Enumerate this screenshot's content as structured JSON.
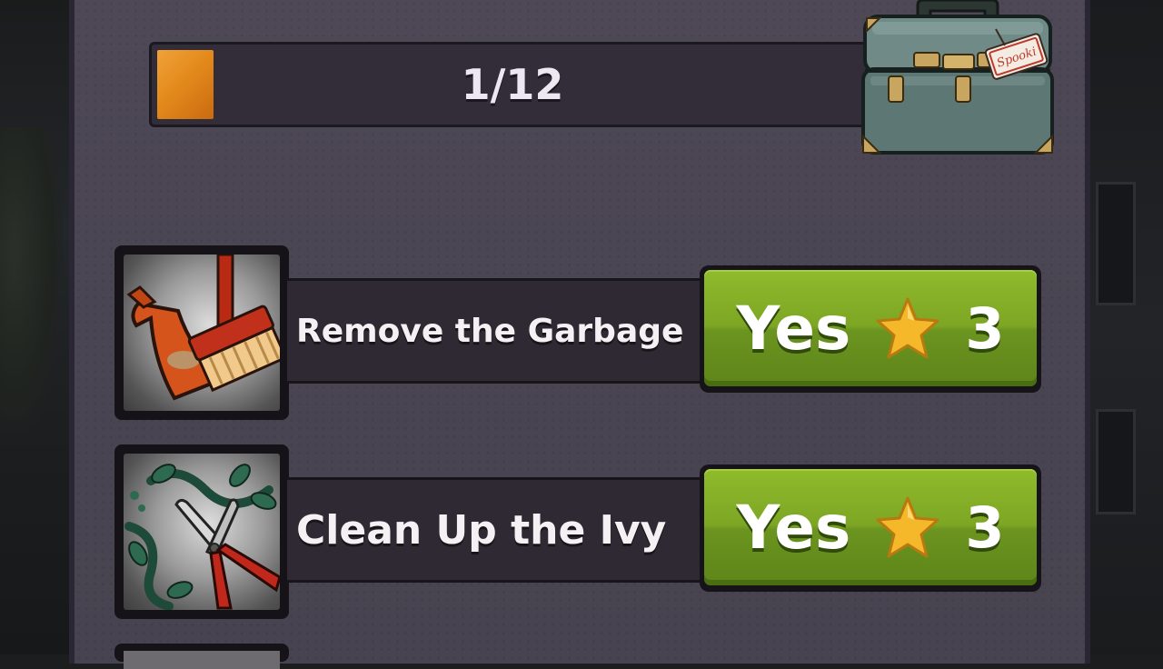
{
  "progress": {
    "text": "1/12",
    "current": 1,
    "total": 12,
    "fill_color": "#e48a1c"
  },
  "reward_box": {
    "icon": "toolbox-icon",
    "tag_text": "Spooki"
  },
  "tasks": [
    {
      "label": "Remove the Garbage",
      "icon": "dustpan-broom-icon",
      "button_label": "Yes",
      "cost_icon": "star-icon",
      "cost": "3"
    },
    {
      "label": "Clean Up the Ivy",
      "icon": "pruning-shears-ivy-icon",
      "button_label": "Yes",
      "cost_icon": "star-icon",
      "cost": "3"
    }
  ],
  "colors": {
    "panel": "#4a4552",
    "button_green": "#7da624",
    "star": "#f5b82a",
    "progress_orange": "#e48a1c"
  }
}
